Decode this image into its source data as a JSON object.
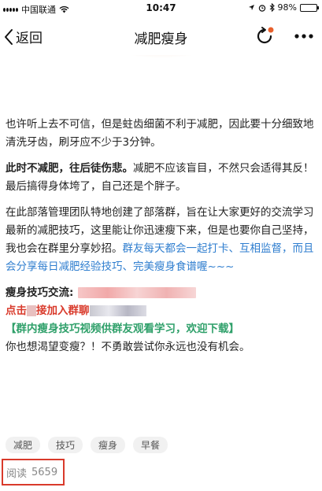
{
  "status_bar": {
    "carrier": "中国联通",
    "time": "10:47",
    "battery": "98%",
    "battery_level": 0.98
  },
  "nav": {
    "back_label": "返回",
    "title": "减肥瘦身"
  },
  "article": {
    "p1": "也许听上去不可信，但是蛀齿细菌不利于减肥，因此要十分细致地清洗牙齿，刷牙应不少于3分钟。",
    "p2_bold": "此时不减肥，往后徒伤悲。",
    "p2_rest": "减肥不应该盲目，不然只会适得其反！最后搞得身体垮了，自己还是个胖子。",
    "p3": "在此部落管理团队特地创建了部落群，旨在让大家更好的交流学习最新的减肥技巧，这里能让你迅速瘦下来，但是也要你自己坚持，我也会在群里分享妙招。",
    "p3_blue": "群友每天都会一起打卡、互相监督，而且会分享每日减肥经验技巧、完美瘦身食谱喔~~~",
    "contact_label": "瘦身技巧交流:",
    "join_prefix": "点击",
    "join_mid": "接加入群聊",
    "video_note": "【群内瘦身技巧视频供群友观看学习，欢迎下载】",
    "closing": "你也想渴望变瘦？！不勇敢尝试你永远也没有机会。"
  },
  "tags": [
    "减肥",
    "技巧",
    "瘦身",
    "早餐"
  ],
  "read": {
    "label": "阅读",
    "count": "5659"
  },
  "colors": {
    "accent_red": "#d93a2b",
    "link_blue": "#2f7ecf",
    "note_green": "#2fa06a"
  }
}
